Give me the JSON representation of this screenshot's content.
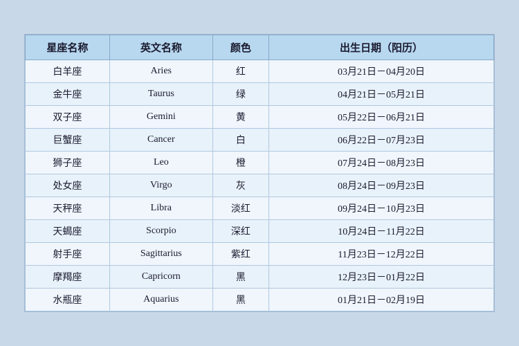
{
  "table": {
    "headers": {
      "chinese_name": "星座名称",
      "english_name": "英文名称",
      "color": "颜色",
      "birthday": "出生日期（阳历）"
    },
    "rows": [
      {
        "chinese": "白羊座",
        "english": "Aries",
        "color": "红",
        "date": "03月21日－04月20日"
      },
      {
        "chinese": "金牛座",
        "english": "Taurus",
        "color": "绿",
        "date": "04月21日－05月21日"
      },
      {
        "chinese": "双子座",
        "english": "Gemini",
        "color": "黄",
        "date": "05月22日－06月21日"
      },
      {
        "chinese": "巨蟹座",
        "english": "Cancer",
        "color": "白",
        "date": "06月22日－07月23日"
      },
      {
        "chinese": "狮子座",
        "english": "Leo",
        "color": "橙",
        "date": "07月24日－08月23日"
      },
      {
        "chinese": "处女座",
        "english": "Virgo",
        "color": "灰",
        "date": "08月24日－09月23日"
      },
      {
        "chinese": "天秤座",
        "english": "Libra",
        "color": "淡红",
        "date": "09月24日－10月23日"
      },
      {
        "chinese": "天蝎座",
        "english": "Scorpio",
        "color": "深红",
        "date": "10月24日－11月22日"
      },
      {
        "chinese": "射手座",
        "english": "Sagittarius",
        "color": "紫红",
        "date": "11月23日－12月22日"
      },
      {
        "chinese": "摩羯座",
        "english": "Capricorn",
        "color": "黑",
        "date": "12月23日－01月22日"
      },
      {
        "chinese": "水瓶座",
        "english": "Aquarius",
        "color": "黑",
        "date": "01月21日－02月19日"
      }
    ]
  }
}
